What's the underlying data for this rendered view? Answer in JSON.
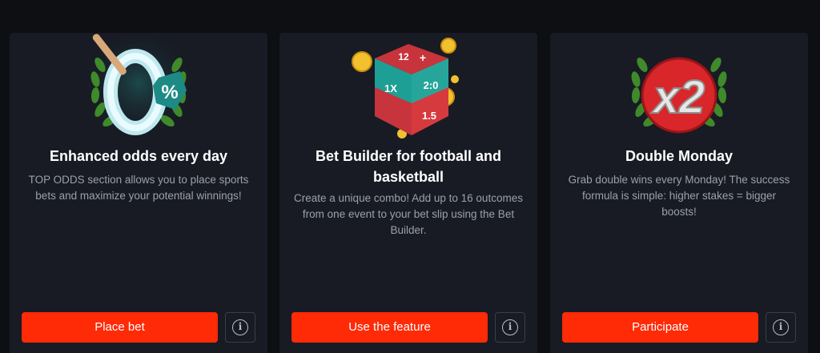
{
  "promos": [
    {
      "title": "Enhanced odds every day",
      "description": "TOP ODDS section allows you to place sports bets and maximize your potential winnings!",
      "button_label": "Place bet",
      "info_icon": "i",
      "art": {
        "icon": "zero-percent-badge-icon",
        "badge_text": "%"
      }
    },
    {
      "title": "Bet Builder for football and basketball",
      "description": "Create a unique combo! Add up to 16 outcomes from one event to your bet slip using the Bet Builder.",
      "button_label": "Use the feature",
      "info_icon": "i",
      "art": {
        "icon": "puzzle-cube-icon",
        "face_labels": [
          "12",
          "+",
          "1X",
          "2:0",
          "1.5"
        ]
      }
    },
    {
      "title": "Double Monday",
      "description": "Grab double wins every Monday! The success formula is simple: higher stakes = bigger boosts!",
      "button_label": "Participate",
      "info_icon": "i",
      "art": {
        "icon": "x2-badge-icon",
        "badge_text": "x2"
      }
    }
  ],
  "colors": {
    "background": "#0e0f13",
    "card": "#181b24",
    "accent": "#ff2a06",
    "title": "#ffffff",
    "text": "#9ba0ab"
  }
}
